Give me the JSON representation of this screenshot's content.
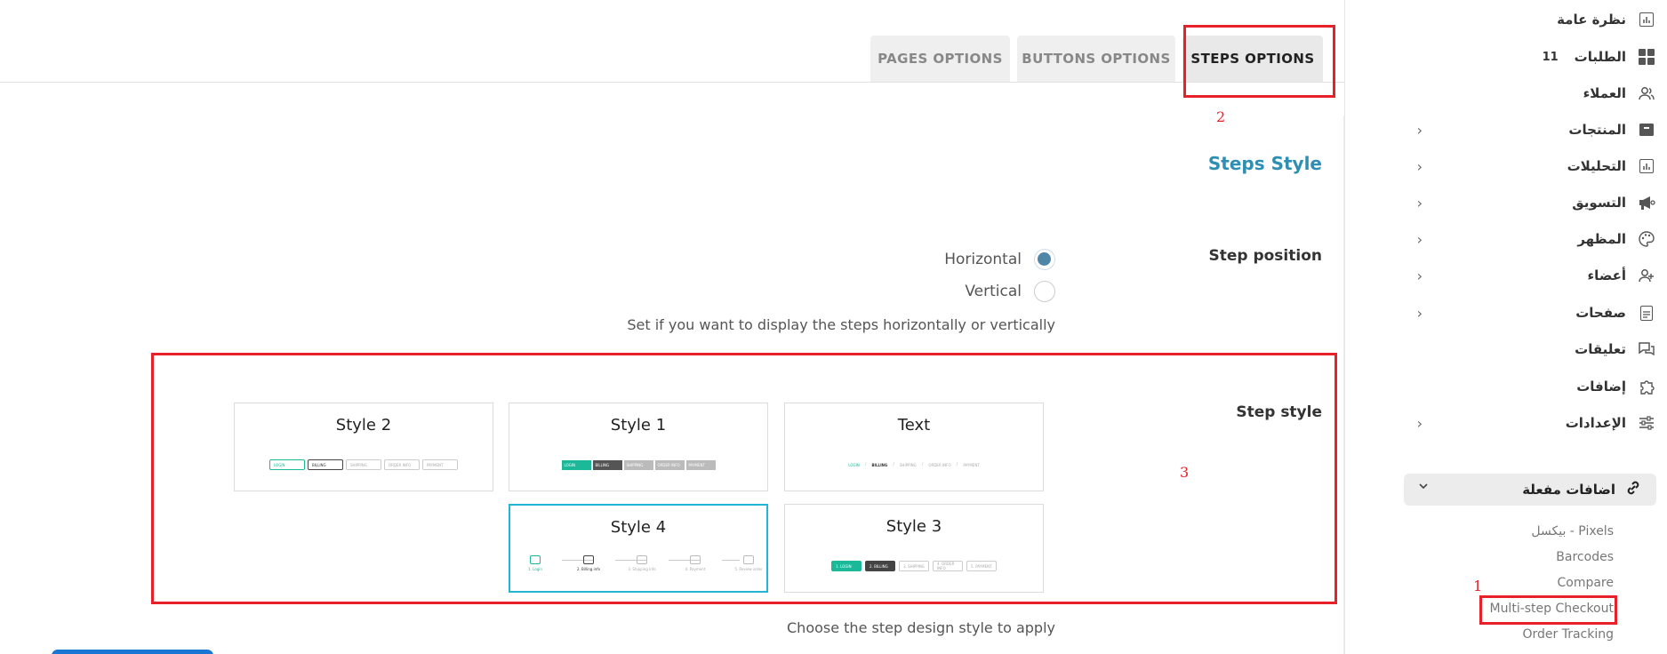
{
  "sidebar": {
    "items": [
      {
        "label": "نظرة عامة",
        "icon": "overview-chart-icon",
        "chevron": false
      },
      {
        "label": "الطلبات",
        "icon": "orders-grid-icon",
        "count": "11",
        "chevron": false
      },
      {
        "label": "العملاء",
        "icon": "customers-icon",
        "chevron": false
      },
      {
        "label": "المنتجات",
        "icon": "products-box-icon",
        "chevron": true
      },
      {
        "label": "التحليلات",
        "icon": "analytics-chart-icon",
        "chevron": true
      },
      {
        "label": "التسويق",
        "icon": "marketing-megaphone-icon",
        "chevron": true
      },
      {
        "label": "المظهر",
        "icon": "appearance-palette-icon",
        "chevron": true
      },
      {
        "label": "أعضاء",
        "icon": "members-icon",
        "chevron": true
      },
      {
        "label": "صفحات",
        "icon": "pages-document-icon",
        "chevron": true
      },
      {
        "label": "تعليقات",
        "icon": "comments-icon",
        "chevron": false
      },
      {
        "label": "إضافات",
        "icon": "addons-puzzle-icon",
        "chevron": false
      },
      {
        "label": "الإعدادات",
        "icon": "settings-sliders-icon",
        "chevron": true
      }
    ],
    "active_group": {
      "label": "اضافات مفعلة",
      "icon": "link-icon"
    },
    "sub_items": [
      "بيكسل - Pixels",
      "Barcodes",
      "Compare",
      "Multi-step Checkout",
      "Order Tracking"
    ]
  },
  "tabs": [
    "PAGES OPTIONS",
    "BUTTONS OPTIONS",
    "STEPS OPTIONS"
  ],
  "active_tab": "STEPS OPTIONS",
  "section_title": "Steps Style",
  "step_position": {
    "label": "Step position",
    "options": [
      "Horizontal",
      "Vertical"
    ],
    "selected": "Horizontal",
    "help": "Set if you want to display the steps horizontally or vertically"
  },
  "step_style": {
    "label": "Step style",
    "cards": [
      "Style 2",
      "Style 1",
      "Text",
      "Style 4",
      "Style 3"
    ],
    "selected": "Style 4",
    "help": "Choose the step design style to apply",
    "preview_steps": [
      "LOGIN",
      "BILLING",
      "SHIPPING",
      "ORDER INFO",
      "PAYMENT"
    ],
    "preview_steps_numbered": [
      "1. LOGIN",
      "2. BILLING",
      "3. SHIPPING",
      "4. ORDER INFO",
      "5. PAYMENT"
    ],
    "preview_steps_style4": [
      "1. Login",
      "2. Billing info",
      "3. Shipping info",
      "4. Payment",
      "5. Review order"
    ]
  },
  "annotations": [
    "1",
    "2",
    "3"
  ],
  "colors": {
    "accent": "#2f8fb3",
    "radio": "#4f86a8",
    "selected_border": "#23b5d3",
    "annotation": "#e8202a",
    "step_green": "#1bb99a"
  }
}
